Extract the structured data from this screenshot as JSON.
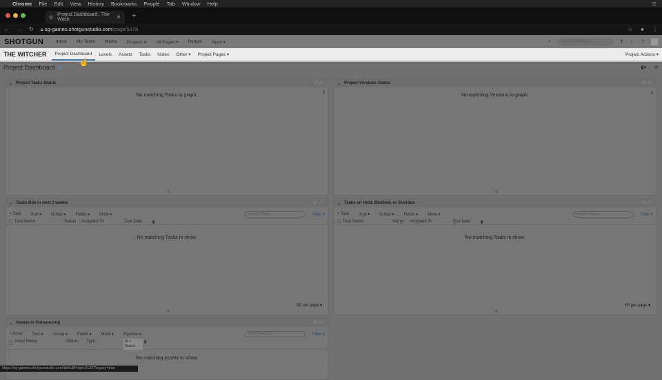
{
  "macmenu": [
    "Chrome",
    "File",
    "Edit",
    "View",
    "History",
    "Bookmarks",
    "People",
    "Tab",
    "Window",
    "Help"
  ],
  "browser": {
    "tab_title": "Project Dashboard : The Witch",
    "url_host": "sg-games.shotgunstudio.com",
    "url_path": "/page/5375"
  },
  "sg_nav": {
    "logo": "SHOTGUN",
    "items": [
      "Inbox",
      "My Tasks",
      "Media",
      "Projects ▾",
      "All Pages ▾",
      "People",
      "Apps ▾"
    ],
    "search_placeholder": "Search Shotgun..."
  },
  "project_nav": {
    "name": "THE WITCHER",
    "items": [
      "Project Dashboard",
      "Levels",
      "Assets",
      "Tasks",
      "Notes",
      "Other ▾",
      "Project Pages ▾"
    ],
    "actions": "Project Actions ▾"
  },
  "page": {
    "title": "Project Dashboard"
  },
  "panels": {
    "tasks_status": {
      "title": "Project Tasks Status",
      "empty": "No matching Tasks to graph."
    },
    "versions_status": {
      "title": "Project Versions Status",
      "empty": "No matching Versions to graph."
    },
    "tasks_due": {
      "title": "Tasks Due in next 2 weeks",
      "toolbar": [
        "+ Task",
        "Sort ▾",
        "Group ▾",
        "Fields ▾",
        "More ▾"
      ],
      "search": "Search Tasks...",
      "filter": "Filter ▾",
      "cols": [
        "Task Name",
        "Status",
        "Assigned To",
        "Due Date"
      ],
      "empty": "No matching Tasks to show.",
      "per_page": "50 per page ▾"
    },
    "tasks_hold": {
      "title": "Tasks on Hold, Blocked, or Overdue",
      "toolbar": [
        "+ Task",
        "Sort ▾",
        "Group ▾",
        "Fields ▾",
        "More ▾"
      ],
      "search": "Search Tasks...",
      "filter": "Filter ▾",
      "cols": [
        "Task Name",
        "Status",
        "Assigned To",
        "Due Date"
      ],
      "empty": "No matching Tasks to show.",
      "per_page": "50 per page ▾"
    },
    "assets": {
      "title": "Assets in Outsourcing",
      "toolbar": [
        "+ Asset",
        "Sort ▾",
        "Group ▾",
        "Fields ▾",
        "More ▾",
        "Pipeline ▾"
      ],
      "search": "Search Assets...",
      "filter": "Filter ▾",
      "cols": [
        "Asset Name",
        "Status",
        "Type"
      ],
      "all_label": "ALL",
      "all_status": "Status",
      "empty": "No matching Assets to show."
    }
  },
  "status_bar": "https://sg-games.shotgunstudio.com/detail/Project/125?legacy=true"
}
